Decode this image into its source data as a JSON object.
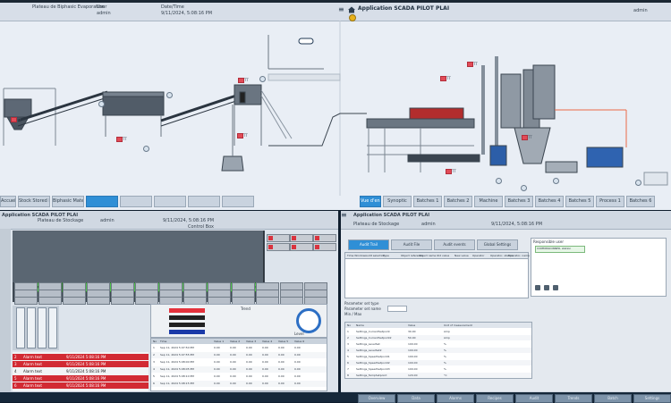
{
  "top_screen": {
    "app_title": "Application SCADA PILOT PLAI",
    "left_info": "Plateau de Biphasic Evaporation",
    "user_label": "User",
    "user_name": "admin",
    "date_label": "Date/Time",
    "datetime": "9/11/2024, 5:08:16 PM",
    "right_user": "admin",
    "status_dot_color": "#e9b21b",
    "tabs": [
      {
        "label": "Accueil"
      },
      {
        "label": "Stock Stored Logic"
      },
      {
        "label": "Biphasic Materials"
      },
      {
        "label": ""
      },
      {
        "label": ""
      },
      {
        "label": ""
      },
      {
        "label": ""
      },
      {
        "label": ""
      }
    ],
    "right_tabs": [
      {
        "label": "Vue d'ens."
      },
      {
        "label": "Synoptic"
      },
      {
        "label": "Batches 1"
      },
      {
        "label": "Batches 2"
      },
      {
        "label": "Machine"
      },
      {
        "label": "Batches 3"
      },
      {
        "label": "Batches 4"
      },
      {
        "label": "Batches 5"
      },
      {
        "label": "Process 1"
      },
      {
        "label": "Batches 6"
      }
    ],
    "pill_label": "",
    "tags": [
      {
        "text": "TT"
      },
      {
        "text": "TT"
      },
      {
        "text": "TT"
      },
      {
        "text": "TT"
      },
      {
        "text": "TT"
      },
      {
        "text": "TT"
      },
      {
        "text": "TT"
      },
      {
        "text": "TT"
      }
    ]
  },
  "left_panel": {
    "title": "Application SCADA PILOT PLAI",
    "header_left": "Plateau de Stockage",
    "user": "admin",
    "datetime": "9/11/2024, 5:08:16 PM",
    "controller": "Control Box",
    "slot_status": [
      "OK",
      "OK",
      "OK",
      "OK",
      "OK",
      "OK",
      "OK",
      "OK",
      "OK",
      "OK",
      "OK",
      "OK",
      "OK",
      "OK",
      "OK",
      "OK"
    ],
    "red_buttons": [
      "",
      "",
      "",
      "",
      "",
      ""
    ],
    "trend_title": "Trend",
    "gauge_label": "Level",
    "alarm_rows": [
      {
        "id": "2",
        "text": "Alarm text",
        "time": "9/11/2024 5:08:16 PM",
        "color": "#d22a33"
      },
      {
        "id": "3",
        "text": "Alarm text",
        "time": "9/11/2024 5:08:16 PM",
        "color": "#d22a33"
      },
      {
        "id": "4",
        "text": "Alarm text",
        "time": "9/11/2024 5:08:16 PM",
        "color": "#f2f4f6"
      },
      {
        "id": "5",
        "text": "Alarm text",
        "time": "9/11/2024 5:08:16 PM",
        "color": "#d22a33"
      },
      {
        "id": "6",
        "text": "Alarm text",
        "time": "9/11/2024 5:08:16 PM",
        "color": "#d22a33"
      }
    ],
    "table_header": [
      "No",
      "Time",
      "Value 1",
      "Value 2",
      "Value 3",
      "Value 4",
      "Value 5",
      "Value 6"
    ],
    "data_rows": [
      [
        "1",
        "Sep 11, 2024 5:07:50 PM",
        "0.00",
        "0.00",
        "0.00",
        "0.00",
        "0.00",
        "0.00"
      ],
      [
        "2",
        "Sep 11, 2024 5:07:55 PM",
        "0.00",
        "0.00",
        "0.00",
        "0.00",
        "0.00",
        "0.00"
      ],
      [
        "3",
        "Sep 11, 2024 5:08:00 PM",
        "0.00",
        "0.00",
        "0.00",
        "0.00",
        "0.00",
        "0.00"
      ],
      [
        "4",
        "Sep 11, 2024 5:08:05 PM",
        "0.00",
        "0.00",
        "0.00",
        "0.00",
        "0.00",
        "0.00"
      ],
      [
        "5",
        "Sep 11, 2024 5:08:10 PM",
        "0.00",
        "0.00",
        "0.00",
        "0.00",
        "0.00",
        "0.00"
      ],
      [
        "6",
        "Sep 11, 2024 5:08:15 PM",
        "0.00",
        "0.00",
        "0.00",
        "0.00",
        "0.00",
        "0.00"
      ]
    ],
    "bar_colors": [
      "#e4323c",
      "#222222",
      "#222222",
      "#1a3aa8"
    ]
  },
  "right_panel": {
    "title": "Application SCADA PILOT PLAI",
    "header_left": "Plateau de Stockage",
    "user": "admin",
    "datetime": "9/11/2024, 5:08:16 PM",
    "tabs": [
      "Audit Trail",
      "Audit File",
      "Audit events",
      "Global Settings"
    ],
    "toolbar_labels": [
      "Time Window",
      "Audit selection",
      "Type",
      "Object reference",
      "Object name",
      "Old value",
      "New value",
      "Operator",
      "Operator, station",
      "Operator, name"
    ],
    "side_title": "Responsible user",
    "side_item": "COMMISSIONNER, station",
    "params_title": "Parameter set type",
    "params_fields": [
      "Parameter set name",
      "Min / Max"
    ],
    "settings_table_header": [
      "No",
      "Name",
      "Value",
      "Unit of measurement"
    ],
    "settings_rows": [
      [
        "1",
        "Settings_CurrentSetpoint",
        "30.00",
        "Amp"
      ],
      [
        "2",
        "Settings_CurrentSetpoint2",
        "50.00",
        "Amp"
      ],
      [
        "3",
        "Settings_LevelSet",
        "100.00",
        "%"
      ],
      [
        "4",
        "Settings_LevelSet2",
        "100.00",
        "%"
      ],
      [
        "5",
        "Settings_SpeedSetpoint1",
        "100.00",
        "%"
      ],
      [
        "6",
        "Settings_SpeedSetpoint2",
        "100.00",
        "%"
      ],
      [
        "7",
        "Settings_SpeedSetpoint3",
        "100.00",
        "%"
      ],
      [
        "8",
        "Settings_TempSetpoint",
        "120.00",
        "°C"
      ]
    ]
  },
  "footer": {
    "buttons": [
      "Overview",
      "Data",
      "Alarms",
      "Recipes",
      "Audit",
      "Trends",
      "Batch",
      "Settings"
    ]
  }
}
